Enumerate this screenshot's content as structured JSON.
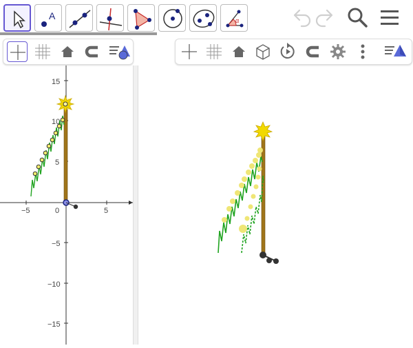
{
  "toolbar": {
    "tools": [
      {
        "name": "move-tool-icon"
      },
      {
        "name": "point-tool-icon"
      },
      {
        "name": "line-tool-icon"
      },
      {
        "name": "perpendicular-line-tool-icon"
      },
      {
        "name": "polygon-tool-icon"
      },
      {
        "name": "circle-tool-icon"
      },
      {
        "name": "ellipse-tool-icon"
      },
      {
        "name": "angle-tool-icon"
      }
    ],
    "selected_tool": "move",
    "right_icons": [
      "undo-icon",
      "redo-icon",
      "search-icon",
      "menu-icon"
    ]
  },
  "view2d": {
    "style_bar": [
      "axes-toggle-icon",
      "grid-toggle-icon",
      "home-icon",
      "magnet-icon",
      "view-options-icon"
    ],
    "x_ticks": [
      "−5",
      "0",
      "5"
    ],
    "y_ticks": [
      "15",
      "10",
      "5",
      "−5",
      "−10",
      "−15"
    ]
  },
  "view3d": {
    "style_bar": [
      "axes-toggle-icon",
      "grid-toggle-icon",
      "home-icon",
      "cube-view-icon",
      "rotate-view-icon",
      "magnet-icon",
      "settings-gear-icon",
      "more-vertical-icon",
      "view-options-icon"
    ]
  },
  "colors": {
    "accent": "#6557d2",
    "curve": "#1fa31f",
    "pole": "#a0751a",
    "point": "#f2ec6d",
    "star": "#e8d000"
  }
}
